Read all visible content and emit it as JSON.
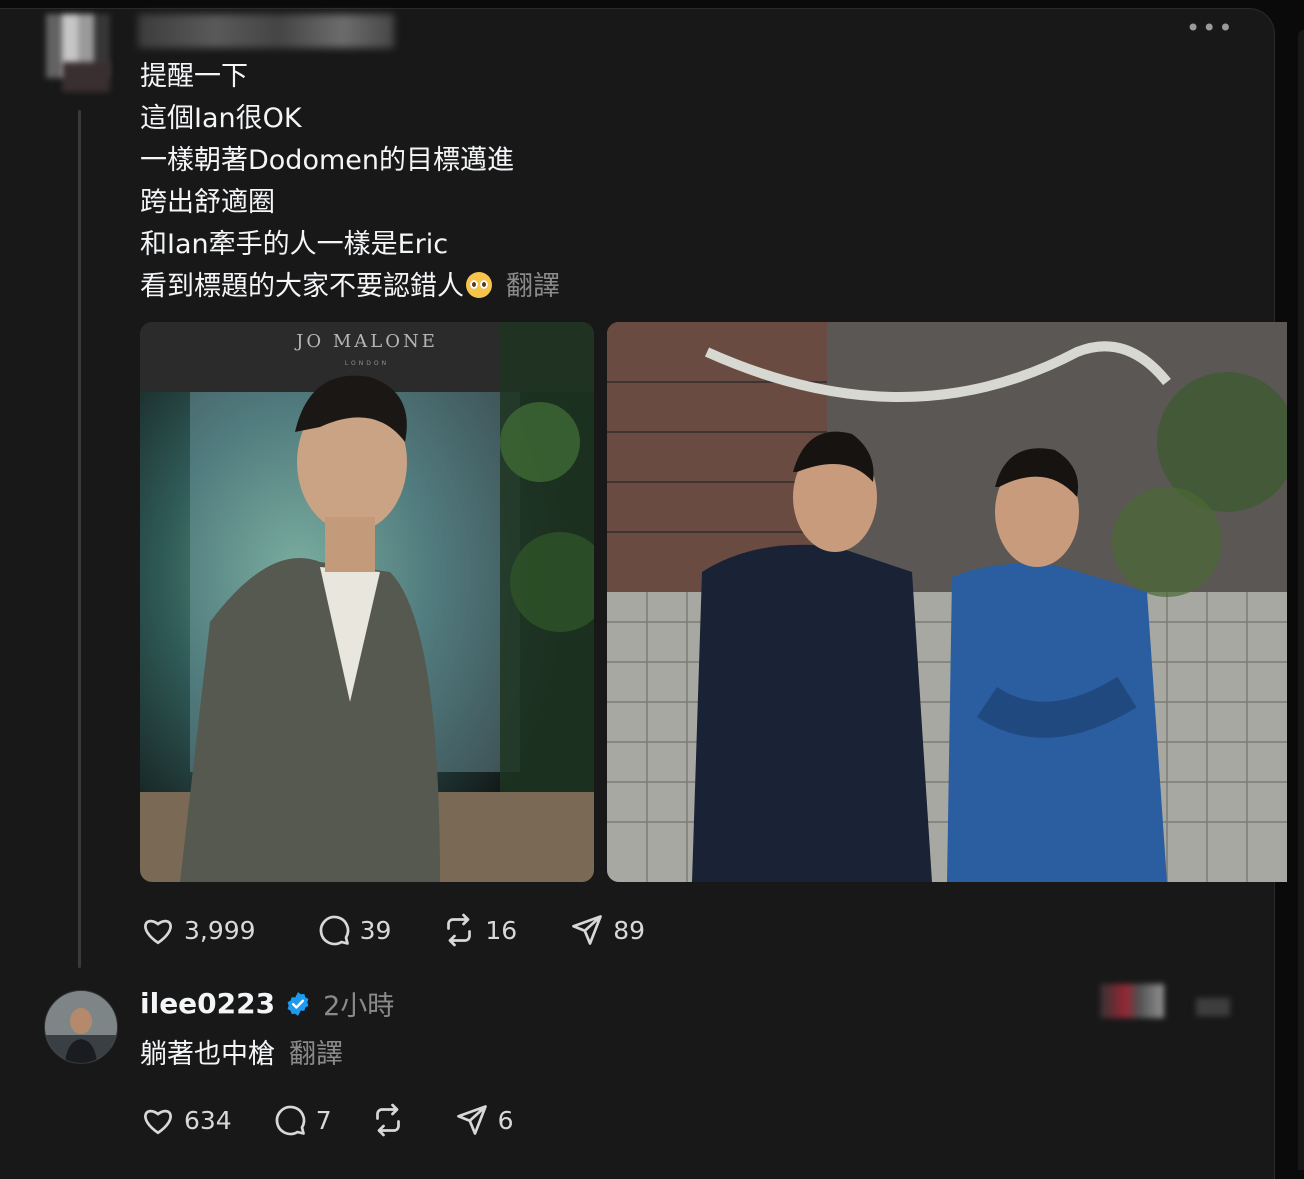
{
  "post": {
    "lines": [
      "提醒一下",
      "這個Ian很OK",
      "一樣朝著Dodomen的目標邁進",
      "跨出舒適圈",
      "和Ian牽手的人一樣是Eric",
      "看到標題的大家不要認錯人"
    ],
    "translate_label": "翻譯",
    "more_label": "•••",
    "image1_caption": "JO MALONE",
    "image1_subcaption": "LONDON",
    "stats": {
      "likes": "3,999",
      "comments": "39",
      "reposts": "16",
      "shares": "89"
    }
  },
  "reply": {
    "username": "ilee0223",
    "time": "2小時",
    "text": "躺著也中槍",
    "translate_label": "翻譯",
    "stats": {
      "likes": "634",
      "comments": "7",
      "reposts": "",
      "shares": "6"
    }
  },
  "colors": {
    "background": "#181818",
    "text": "#f3f5f7",
    "muted": "#8a8a8a",
    "verified": "#1d9bf0"
  }
}
